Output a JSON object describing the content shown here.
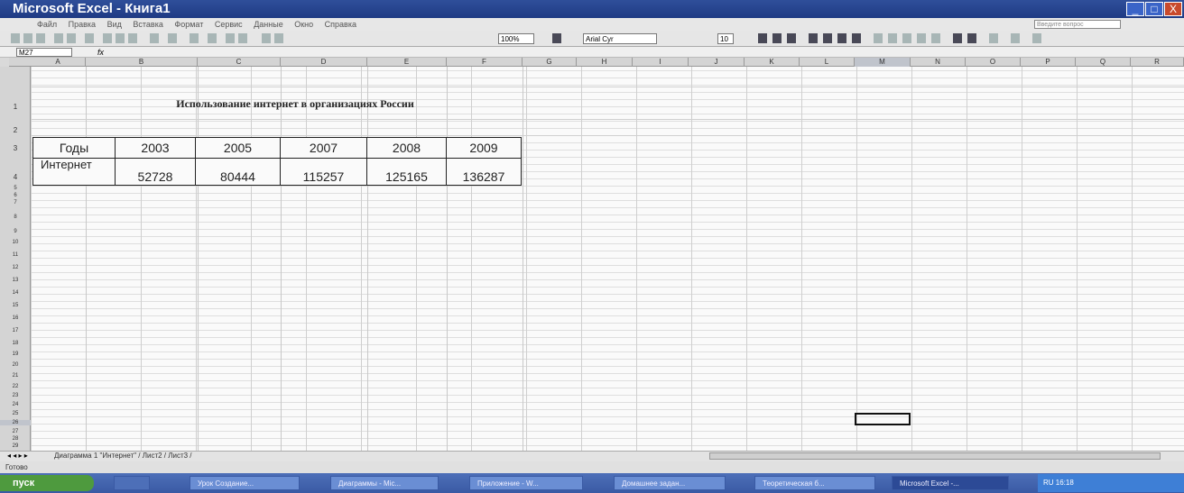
{
  "window": {
    "title": "Microsoft Excel - Книга1",
    "controls": [
      "_",
      "□",
      "X"
    ]
  },
  "menu": {
    "items": [
      "Файл",
      "Правка",
      "Вид",
      "Вставка",
      "Формат",
      "Сервис",
      "Данные",
      "Окно",
      "Справка"
    ],
    "help_placeholder": "Введите вопрос"
  },
  "toolbar": {
    "zoom": "100%",
    "font": "Arial Cyr",
    "size": "10"
  },
  "formula_bar": {
    "name_box": "M27",
    "fx": "fx"
  },
  "columns": [
    "A",
    "B",
    "C",
    "D",
    "E",
    "F",
    "G",
    "H",
    "I",
    "J",
    "K",
    "L",
    "M",
    "N",
    "O",
    "P",
    "Q",
    "R"
  ],
  "rows": [
    "1",
    "2",
    "3",
    "4",
    "5",
    "6",
    "7",
    "8",
    "9",
    "10",
    "11",
    "12",
    "13",
    "14",
    "15",
    "16",
    "17",
    "18",
    "19",
    "20",
    "21",
    "22",
    "23",
    "24",
    "25",
    "26",
    "27",
    "28",
    "29"
  ],
  "sheet": {
    "title": "Использование интернет в организациях России",
    "table": {
      "row_labels": [
        "Годы",
        "Интернет"
      ],
      "years": [
        "2003",
        "2005",
        "2007",
        "2008",
        "2009"
      ],
      "values": [
        "52728",
        "80444",
        "115257",
        "125165",
        "136287"
      ]
    }
  },
  "sheet_tabs": {
    "text": "Диаграмма 1 \"Интернет\" / Лист2 / Лист3 /"
  },
  "status": {
    "text": "Готово"
  },
  "taskbar": {
    "start": "пуск",
    "tasks": [
      "Урок Создание...",
      "Диаграммы - Mic...",
      "Приложение - W...",
      "Домашнее задан...",
      "Теоретическая б...",
      "Microsoft Excel -..."
    ],
    "tray": "RU  16:18"
  }
}
